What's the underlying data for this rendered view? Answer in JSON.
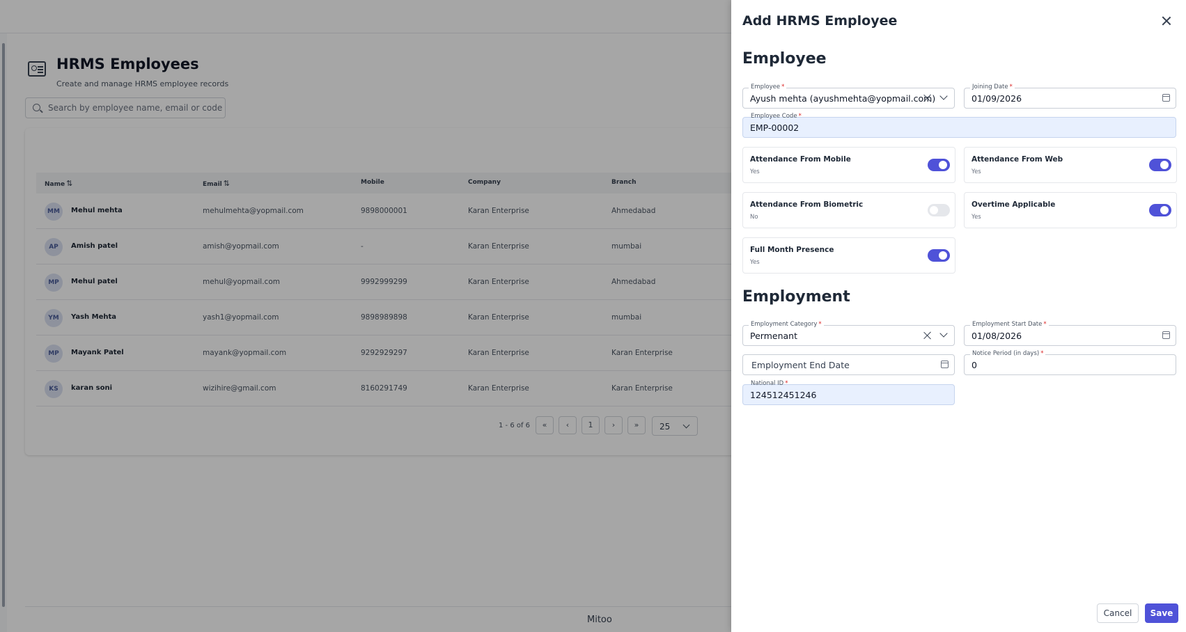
{
  "page": {
    "title": "HRMS Employees",
    "subtitle": "Create and manage HRMS employee records",
    "search_placeholder": "Search by employee name, email or code...",
    "footer_brand": "Mitoo"
  },
  "table": {
    "columns": {
      "name": "Name",
      "email": "Email",
      "mobile": "Mobile",
      "company": "Company",
      "branch": "Branch",
      "sort_glyph": "⇅"
    },
    "rows": [
      {
        "initials": "MM",
        "name": "Mehul mehta",
        "email": "mehulmehta@yopmail.com",
        "mobile": "9898000001",
        "company": "Karan Enterprise",
        "branch": "Ahmedabad"
      },
      {
        "initials": "AP",
        "name": "Amish patel",
        "email": "amish@yopmail.com",
        "mobile": "-",
        "company": "Karan Enterprise",
        "branch": "mumbai"
      },
      {
        "initials": "MP",
        "name": "Mehul patel",
        "email": "mehul@yopmail.com",
        "mobile": "9992999299",
        "company": "Karan Enterprise",
        "branch": "Ahmedabad"
      },
      {
        "initials": "YM",
        "name": "Yash Mehta",
        "email": "yash1@yopmail.com",
        "mobile": "9898989898",
        "company": "Karan Enterprise",
        "branch": "mumbai"
      },
      {
        "initials": "MP",
        "name": "Mayank Patel",
        "email": "mayank@yopmail.com",
        "mobile": "9292929297",
        "company": "Karan Enterprise",
        "branch": "Karan Enterprise"
      },
      {
        "initials": "KS",
        "name": "karan soni",
        "email": "wizihire@gmail.com",
        "mobile": "8160291749",
        "company": "Karan Enterprise",
        "branch": "Karan Enterprise"
      }
    ]
  },
  "pagination": {
    "info": "1 - 6 of 6",
    "first": "«",
    "prev": "‹",
    "current_page": "1",
    "next": "›",
    "last": "»",
    "page_size": "25"
  },
  "drawer": {
    "title": "Add HRMS Employee",
    "employee_section": {
      "title": "Employee",
      "employee": {
        "label": "Employee",
        "value": "Ayush mehta (ayushmehta@yopmail.com)"
      },
      "joining_date": {
        "label": "Joining Date",
        "value": "01/09/2026"
      },
      "employee_code": {
        "label": "Employee Code",
        "value": "EMP-00002"
      },
      "toggles": [
        {
          "label": "Attendance From Mobile",
          "state": "Yes"
        },
        {
          "label": "Attendance From Web",
          "state": "Yes"
        },
        {
          "label": "Attendance From Biometric",
          "state": "No"
        },
        {
          "label": "Overtime Applicable",
          "state": "Yes"
        },
        {
          "label": "Full Month Presence",
          "state": "Yes"
        }
      ]
    },
    "employment_section": {
      "title": "Employment",
      "category": {
        "label": "Employment Category",
        "value": "Permenant"
      },
      "start_date": {
        "label": "Employment Start Date",
        "value": "01/08/2026"
      },
      "end_date": {
        "placeholder": "Employment End Date"
      },
      "notice_period": {
        "label": "Notice Period (in days)",
        "value": "0"
      },
      "national_id": {
        "label": "National ID",
        "value": "124512451246"
      }
    },
    "required_mark": "*",
    "cancel_label": "Cancel",
    "save_label": "Save"
  },
  "colors": {
    "accent": "#4f52d8",
    "toggle_off": "#e5e7eb",
    "required": "#dc2626",
    "filled_field": "#e8f0fe"
  }
}
